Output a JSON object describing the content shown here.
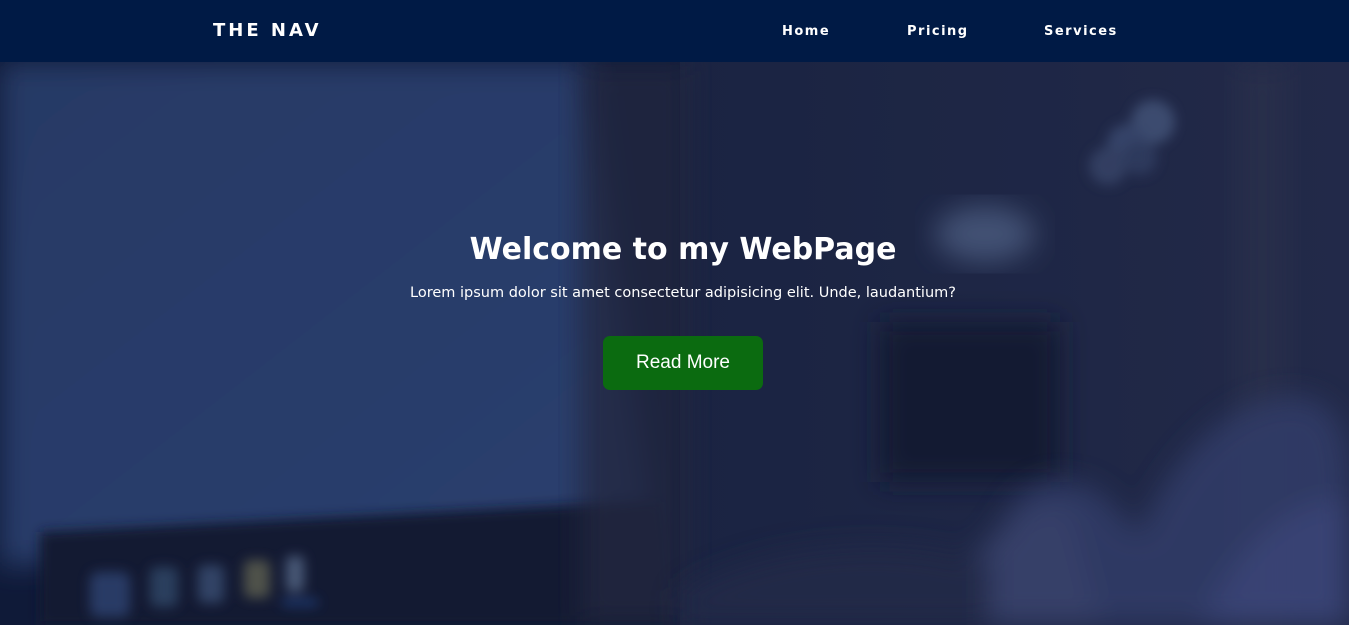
{
  "nav": {
    "brand": "THE NAV",
    "links": [
      {
        "label": "Home"
      },
      {
        "label": "Pricing"
      },
      {
        "label": "Services"
      }
    ],
    "background_color": "#001a45"
  },
  "hero": {
    "title": "Welcome to my WebPage",
    "subtitle": "Lorem ipsum dolor sit amet consectetur adipisicing elit. Unde, laudantium?",
    "button_label": "Read More",
    "button_color": "#0b6b10",
    "background_image": "blurred-laptop-photo"
  }
}
